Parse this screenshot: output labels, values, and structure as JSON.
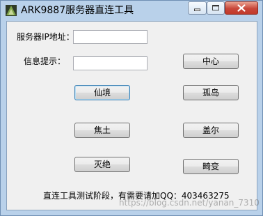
{
  "window": {
    "title": "ARK9887服务器直连工具"
  },
  "form": {
    "server_ip_label": "服务器IP地址：",
    "server_ip_value": "",
    "info_label": "信息提示：",
    "info_value": ""
  },
  "buttons": {
    "center": "中心",
    "xianjing": "仙境",
    "gudao": "孤岛",
    "jiaotu": "焦土",
    "gaier": "盖尔",
    "miejue": "灭绝",
    "jibian": "畸变"
  },
  "status_text": "直连工具测试阶段，有需要请加QQ：403463275",
  "watermark": "https://blog.csdn.net/yanan_7310",
  "colors": {
    "titlebar": "#b9d1ea",
    "client_bg": "#f0f0f0",
    "close_button": "#c8473a"
  }
}
